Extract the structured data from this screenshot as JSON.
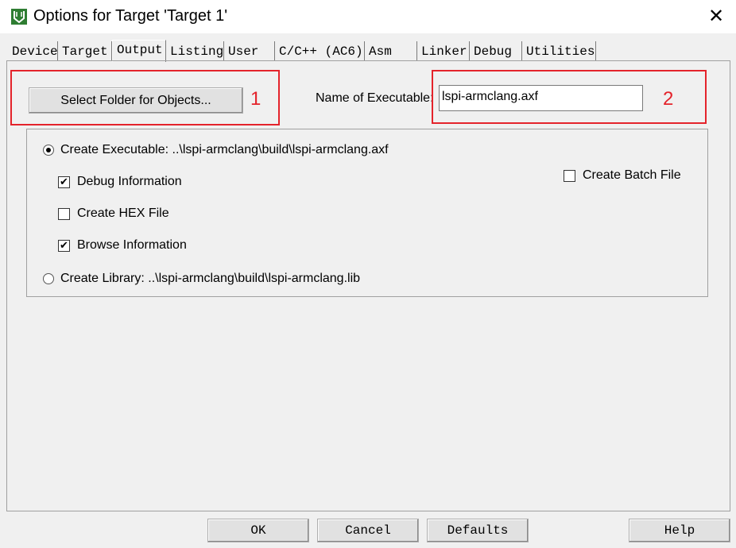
{
  "window": {
    "title": "Options for Target 'Target 1'",
    "close_glyph": "✕",
    "icon": "keil-uvision-icon"
  },
  "tabs": [
    {
      "label": "Device"
    },
    {
      "label": "Target"
    },
    {
      "label": "Output",
      "active": true
    },
    {
      "label": "Listing"
    },
    {
      "label": "User"
    },
    {
      "label": "C/C++ (AC6)"
    },
    {
      "label": "Asm"
    },
    {
      "label": "Linker"
    },
    {
      "label": "Debug"
    },
    {
      "label": "Utilities"
    }
  ],
  "output": {
    "select_folder_label": "Select Folder for Objects...",
    "name_exec_label": "Name of Executable:",
    "name_exec_value": "lspi-armclang.axf",
    "create_exec_label": "Create Executable:  ..\\lspi-armclang\\build\\lspi-armclang.axf",
    "create_exec_selected": true,
    "debug_info_label": "Debug Information",
    "debug_info_checked": true,
    "hex_file_label": "Create HEX File",
    "hex_file_checked": false,
    "browse_info_label": "Browse Information",
    "browse_info_checked": true,
    "create_lib_label": "Create Library:  ..\\lspi-armclang\\build\\lspi-armclang.lib",
    "create_lib_selected": false,
    "batch_file_label": "Create Batch File",
    "batch_file_checked": false
  },
  "annotations": [
    {
      "number": "1",
      "color": "#e4232b"
    },
    {
      "number": "2",
      "color": "#e4232b"
    }
  ],
  "buttons": {
    "ok": "OK",
    "cancel": "Cancel",
    "defaults": "Defaults",
    "help": "Help"
  }
}
